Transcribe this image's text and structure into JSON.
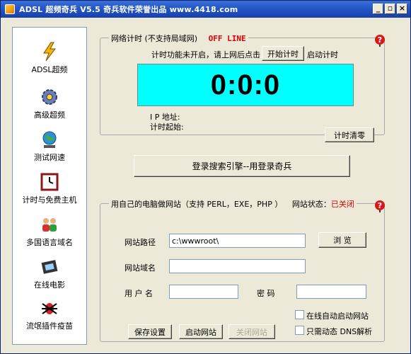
{
  "window": {
    "title": "ADSL 超频奇兵 V5.5  奇兵软件荣誉出品 www.4418.com"
  },
  "sidebar": {
    "items": [
      {
        "label": "ADSL超频",
        "icon": "lightning-icon"
      },
      {
        "label": "高级超频",
        "icon": "gear-icon"
      },
      {
        "label": "测试网速",
        "icon": "globe-icon"
      },
      {
        "label": "计时与免费主机",
        "icon": "clock-icon"
      },
      {
        "label": "多国语言域名",
        "icon": "people-icon"
      },
      {
        "label": "在线电影",
        "icon": "film-icon"
      },
      {
        "label": "流氓插件疫苗",
        "icon": "bug-icon"
      }
    ]
  },
  "timer": {
    "group_title": "网络计时 (不支持局域网)",
    "status": "OFF LINE",
    "hint_before": "计时功能未开启，请上网后点击",
    "start_button": "开始计时",
    "hint_after": "启动计时",
    "display": "0:0:0",
    "ip_label": "I P 地址:",
    "start_label": "计时起始:",
    "reset_button": "计时清零"
  },
  "search_login_button": "登录搜索引擎--用登录奇兵",
  "website": {
    "group_title": "用自己的电脑做网站（支持 PERL，EXE，PHP ）",
    "status_label": "网站状态：",
    "status_value": "已关闭",
    "path_label": "网站路径",
    "path_value": "c:\\wwwroot\\",
    "browse_button": "浏  览",
    "domain_label": "网站域名",
    "domain_value": "",
    "user_label": "用 户 名",
    "user_value": "",
    "password_label": "密  码",
    "password_value": "",
    "auto_start_label": "在线自动启动网站",
    "dynamic_dns_label": "只需动态 DNS解析",
    "save_button": "保存设置",
    "start_button": "启动网站",
    "close_button": "关闭网站"
  },
  "colors": {
    "display_bg": "#00ffff",
    "offline": "#e00000",
    "titlebar": "#2456c8"
  }
}
